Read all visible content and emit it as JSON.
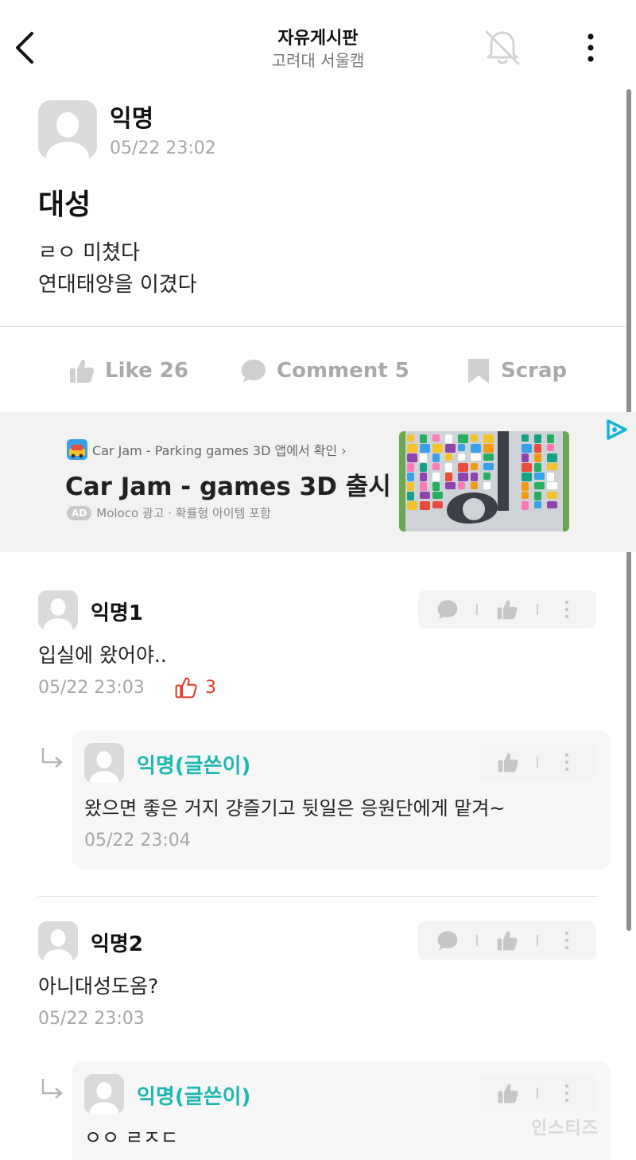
{
  "header": {
    "title": "자유게시판",
    "subtitle": "고려대 서울캠",
    "back_icon": "chevron-left-icon",
    "bell_icon": "bell-off-icon",
    "more_icon": "more-vertical-icon"
  },
  "post": {
    "author": "익명",
    "time": "05/22 23:02",
    "title": "대성",
    "body_lines": [
      "ㄹㅇ 미쳤다",
      "연대태양을 이겼다"
    ]
  },
  "actions": {
    "like_label": "Like 26",
    "comment_label": "Comment 5",
    "scrap_label": "Scrap"
  },
  "ad": {
    "app_line": "Car Jam - Parking games 3D 앱에서 확인 ›",
    "headline": "Car Jam - games 3D 출시",
    "badge": "AD",
    "meta": "Moloco 광고 · 확률형 아이템 포함"
  },
  "comments": [
    {
      "author": "익명1",
      "text": "입실에 왔어야..",
      "time": "05/22 23:03",
      "likes": "3",
      "reply": {
        "author": "익명(글쓴이)",
        "text": "왔으면 좋은 거지 걍즐기고 뒷일은 응원단에게 맡겨~",
        "time": "05/22 23:04"
      }
    },
    {
      "author": "익명2",
      "text": "아니대성도옴?",
      "time": "05/22 23:03",
      "reply": {
        "author": "익명(글쓴이)",
        "text": "ㅇㅇ ㄹㅈㄷ"
      }
    }
  ],
  "watermark": "인스티즈",
  "colors": {
    "op_name": "#1db7b0",
    "like_red": "#e0382b",
    "muted_gray": "#a9a9a9"
  }
}
